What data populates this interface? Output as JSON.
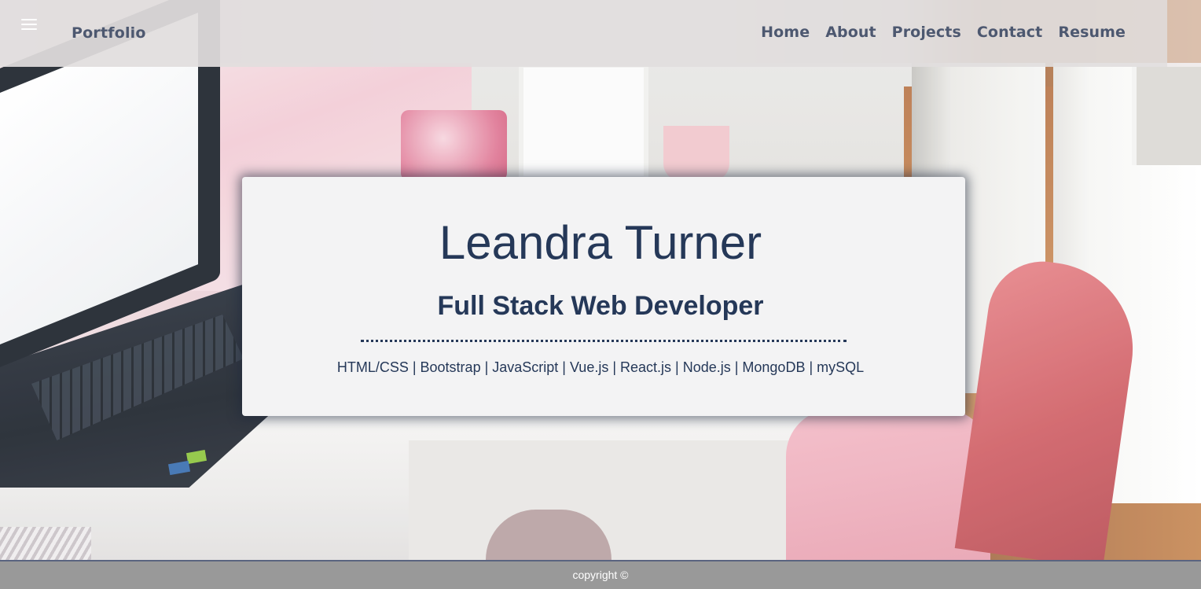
{
  "navbar": {
    "menu_icon": "hamburger-menu-icon",
    "brand": "Portfolio",
    "links": [
      "Home",
      "About",
      "Projects",
      "Contact",
      "Resume"
    ]
  },
  "hero": {
    "name": "Leandra Turner",
    "title": "Full Stack Web Developer",
    "skills": "HTML/CSS | Bootstrap | JavaScript | Vue.js | React.js | Node.js | MongoDB | mySQL"
  },
  "footer": {
    "copyright": "copyright ©"
  },
  "colors": {
    "text_primary": "#253858",
    "nav_text": "#4d5870",
    "footer_bg": "#999999"
  }
}
